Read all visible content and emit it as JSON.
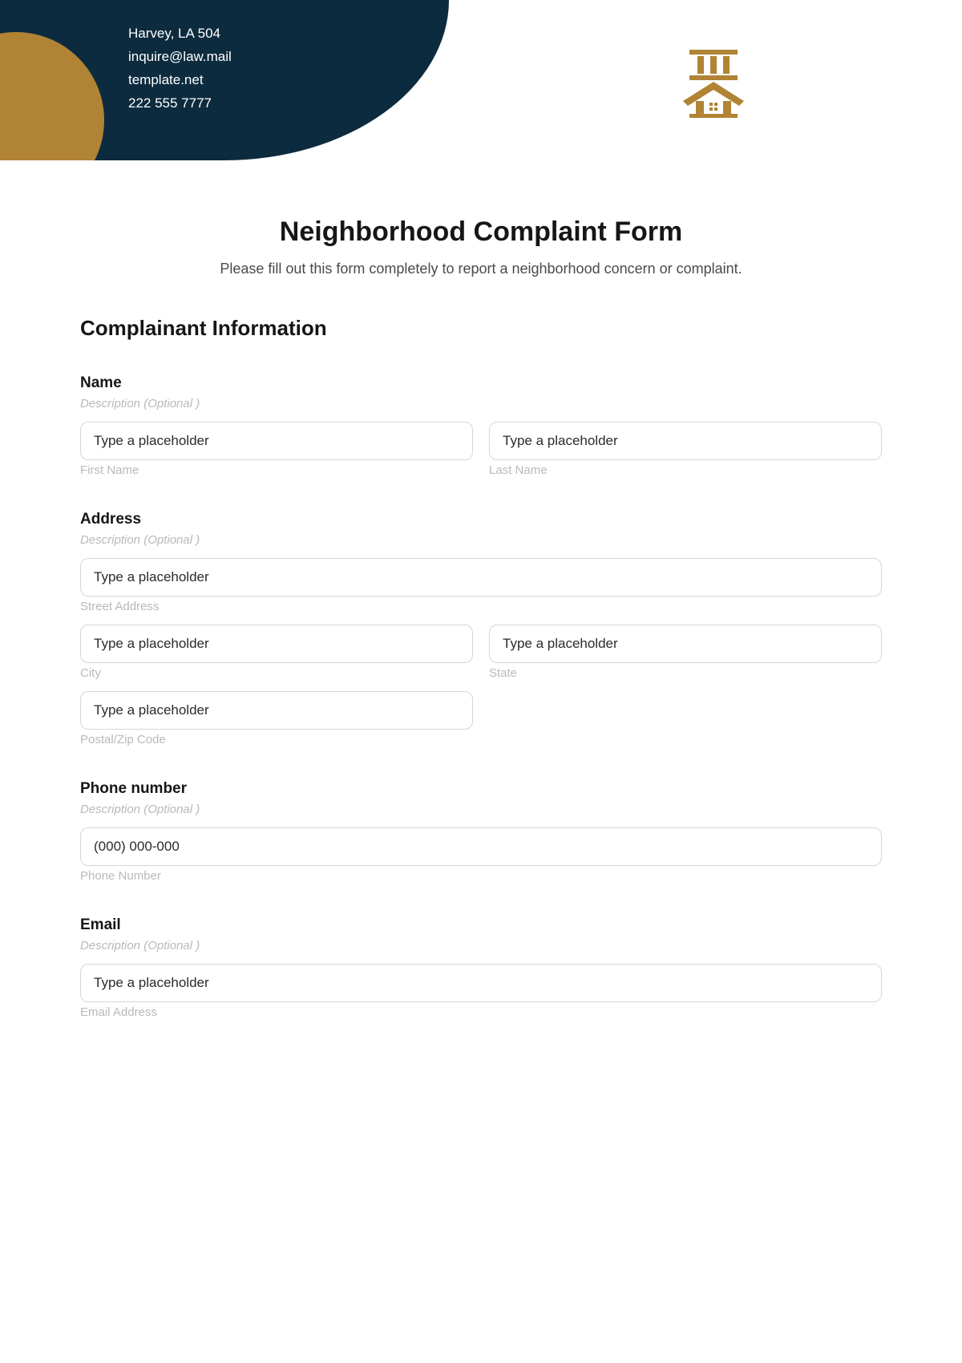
{
  "header": {
    "contact": {
      "line1": "Harvey, LA 504",
      "line2": "inquire@law.mail",
      "line3": "template.net",
      "line4": "222 555 7777"
    }
  },
  "form": {
    "title": "Neighborhood Complaint Form",
    "subtitle": "Please fill out this form completely to report a neighborhood concern or complaint.",
    "section_heading": "Complainant Information",
    "placeholder_text": "Type a placeholder",
    "description_text": "Description (Optional )",
    "name": {
      "label": "Name",
      "first_sub": "First Name",
      "last_sub": "Last Name"
    },
    "address": {
      "label": "Address",
      "street_sub": "Street Address",
      "city_sub": "City",
      "state_sub": "State",
      "zip_sub": "Postal/Zip Code"
    },
    "phone": {
      "label": "Phone number",
      "placeholder": "(000) 000-000",
      "sub": "Phone Number"
    },
    "email": {
      "label": "Email",
      "sub": "Email Address"
    }
  }
}
